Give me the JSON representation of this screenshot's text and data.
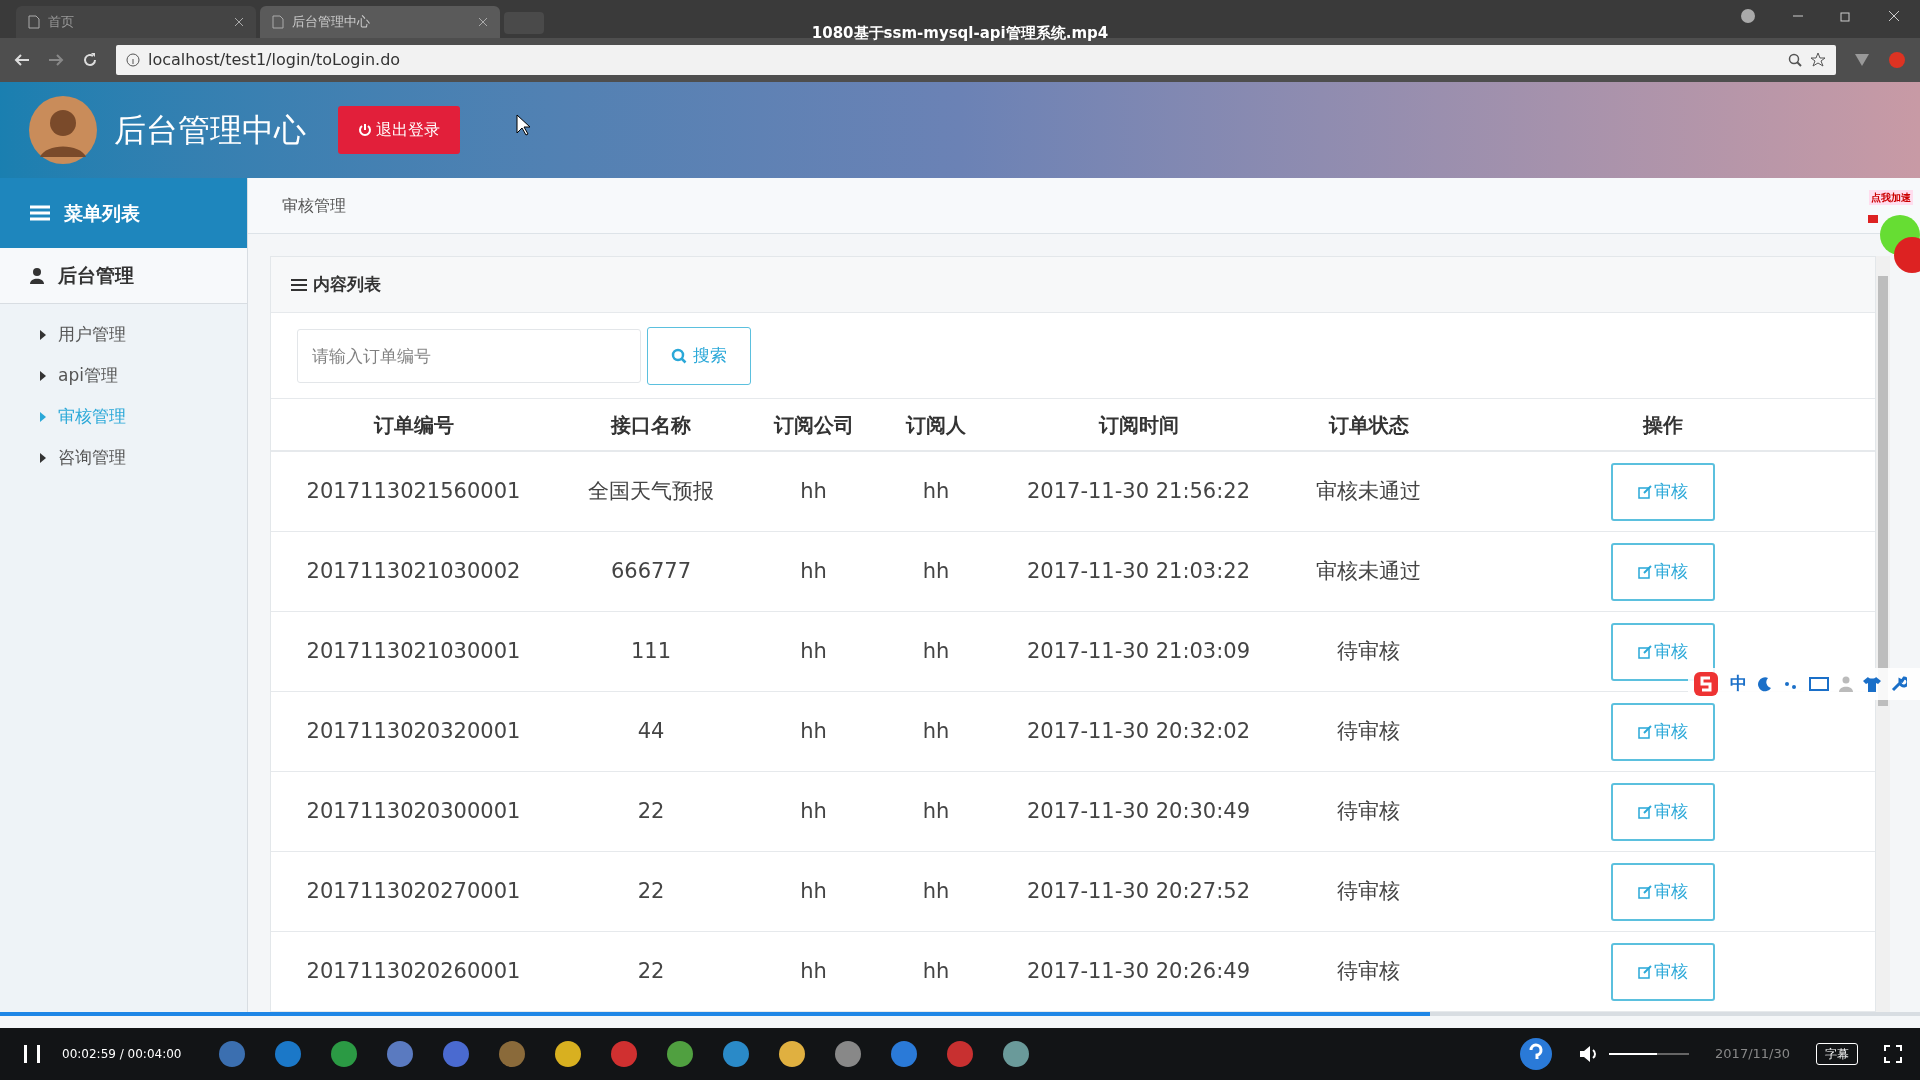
{
  "video_title": "1080基于ssm-mysql-api管理系统.mp4",
  "browser": {
    "tabs": [
      {
        "label": "首页",
        "selected": false
      },
      {
        "label": "后台管理中心",
        "selected": true
      }
    ],
    "url": "localhost/test1/login/toLogin.do"
  },
  "header": {
    "title": "后台管理中心",
    "logout": "退出登录"
  },
  "sidebar": {
    "heading": "菜单列表",
    "section": "后台管理",
    "items": [
      {
        "label": "用户管理",
        "selected": false
      },
      {
        "label": "api管理",
        "selected": false
      },
      {
        "label": "审核管理",
        "selected": true
      },
      {
        "label": "咨询管理",
        "selected": false
      }
    ]
  },
  "breadcrumb": "审核管理",
  "panel": {
    "title": "内容列表",
    "search": {
      "placeholder": "请输入订单编号",
      "button": "搜索"
    }
  },
  "table": {
    "columns": [
      "订单编号",
      "接口名称",
      "订阅公司",
      "订阅人",
      "订阅时间",
      "订单状态",
      "操作"
    ],
    "rows": [
      [
        "2017113021560001",
        "全国天气预报",
        "hh",
        "hh",
        "2017-11-30 21:56:22",
        "审核未通过",
        "审核"
      ],
      [
        "2017113021030002",
        "666777",
        "hh",
        "hh",
        "2017-11-30 21:03:22",
        "审核未通过",
        "审核"
      ],
      [
        "2017113021030001",
        "111",
        "hh",
        "hh",
        "2017-11-30 21:03:09",
        "待审核",
        "审核"
      ],
      [
        "2017113020320001",
        "44",
        "hh",
        "hh",
        "2017-11-30 20:32:02",
        "待审核",
        "审核"
      ],
      [
        "2017113020300001",
        "22",
        "hh",
        "hh",
        "2017-11-30 20:30:49",
        "待审核",
        "审核"
      ],
      [
        "2017113020270001",
        "22",
        "hh",
        "hh",
        "2017-11-30 20:27:52",
        "待审核",
        "审核"
      ],
      [
        "2017113020260001",
        "22",
        "hh",
        "hh",
        "2017-11-30 20:26:49",
        "待审核",
        "审核"
      ]
    ]
  },
  "widget": {
    "label": "点我加速"
  },
  "ime": {
    "label": "中"
  },
  "player": {
    "progress": {
      "level": 0.745
    },
    "time": "00:02:59 / 00:04:00",
    "volume": {
      "level": 0.6
    },
    "subtitle": "字幕",
    "date": "2017/11/30"
  }
}
